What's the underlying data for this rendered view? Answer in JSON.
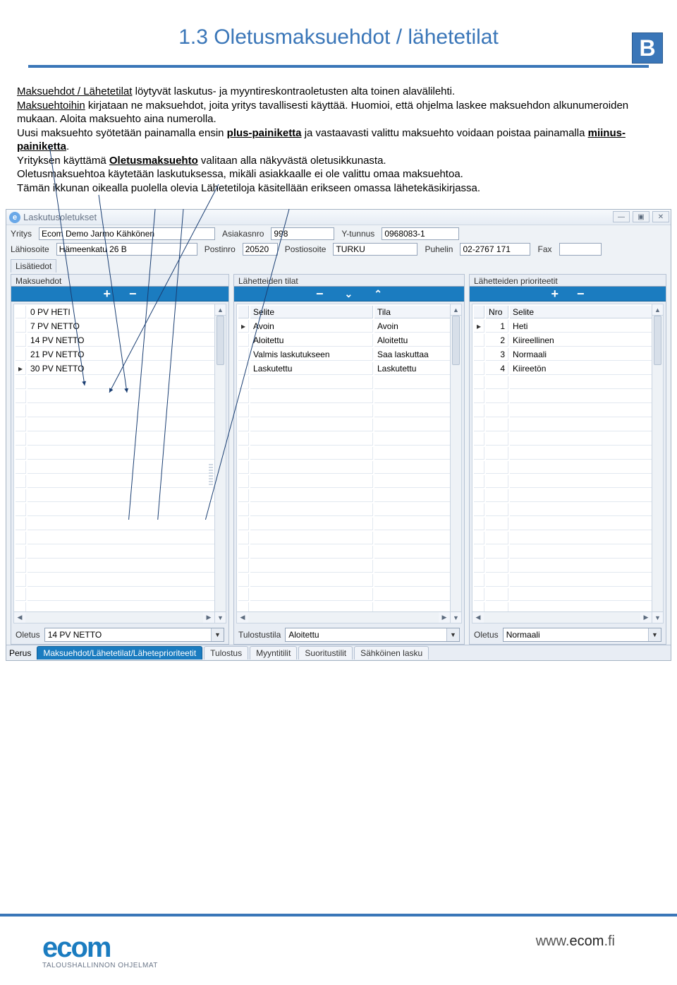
{
  "badge": "B",
  "title": "1.3 Oletusmaksuehdot / lähetetilat",
  "explanation": {
    "l1a": "Maksuehdot / Lähetetilat",
    "l1b": " löytyvät laskutus- ja myyntireskontraoletusten alta toinen alavälilehti.",
    "l2a": "Maksuehtoihin",
    "l2b": " kirjataan ne maksuehdot, joita yritys tavallisesti käyttää. Huomioi, että ohjelma laskee maksuehdon alkunumeroiden mukaan. Aloita maksuehto aina numerolla.",
    "l3a": "Uusi maksuehto syötetään painamalla ensin ",
    "l3b": "plus-painiketta",
    "l3c": " ja vastaavasti valittu maksuehto voidaan poistaa painamalla ",
    "l3d": "miinus-painiketta",
    "l3e": ".",
    "l4a": "Yrityksen käyttämä ",
    "l4b": "Oletusmaksuehto",
    "l4c": " valitaan alla näkyvästä oletusikkunasta.",
    "l5": "Oletusmaksuehtoa käytetään laskutuksessa, mikäli asiakkaalle ei ole valittu omaa maksuehtoa.",
    "l6": "Tämän ikkunan oikealla puolella olevia Lähetetiloja käsitellään erikseen omassa lähetekäsikirjassa."
  },
  "window": {
    "icon": "e",
    "title": "Laskutusoletukset"
  },
  "header": {
    "yritys_lbl": "Yritys",
    "yritys": "Ecom Demo Jarmo Kähkönen",
    "asiakasnro_lbl": "Asiakasnro",
    "asiakasnro": "998",
    "ytunnus_lbl": "Y-tunnus",
    "ytunnus": "0968083-1",
    "lahiosoite_lbl": "Lähiosoite",
    "lahiosoite": "Hämeenkatu 26 B",
    "postinro_lbl": "Postinro",
    "postinro": "20520",
    "postiosoite_lbl": "Postiosoite",
    "postiosoite": "TURKU",
    "puhelin_lbl": "Puhelin",
    "puhelin": "02-2767 171",
    "fax_lbl": "Fax",
    "fax": ""
  },
  "top_tab": "Lisätiedot",
  "panel1": {
    "title": "Maksuehdot",
    "rows": [
      "0 PV HETI",
      "7 PV NETTO",
      "14 PV NETTO",
      "21 PV NETTO",
      "30 PV NETTO"
    ],
    "selected_index": 4,
    "footer_lbl": "Oletus",
    "footer_value": "14 PV NETTO"
  },
  "panel2": {
    "title": "Lähetteiden tilat",
    "col1": "Selite",
    "col2": "Tila",
    "rows": [
      {
        "selite": "Avoin",
        "tila": "Avoin"
      },
      {
        "selite": "Aloitettu",
        "tila": "Aloitettu"
      },
      {
        "selite": "Valmis laskutukseen",
        "tila": "Saa laskuttaa"
      },
      {
        "selite": "Laskutettu",
        "tila": "Laskutettu"
      }
    ],
    "selected_index": 0,
    "footer_lbl": "Tulostustila",
    "footer_value": "Aloitettu"
  },
  "panel3": {
    "title": "Lähetteiden prioriteetit",
    "col1": "Nro",
    "col2": "Selite",
    "rows": [
      {
        "nro": "1",
        "selite": "Heti"
      },
      {
        "nro": "2",
        "selite": "Kiireellinen"
      },
      {
        "nro": "3",
        "selite": "Normaali"
      },
      {
        "nro": "4",
        "selite": "Kiireetön"
      }
    ],
    "selected_index": 0,
    "footer_lbl": "Oletus",
    "footer_value": "Normaali"
  },
  "bottom_tabs": {
    "lbl": "Perus",
    "items": [
      "Maksuehdot/Lähetetilat/Läheteprioriteetit",
      "Tulostus",
      "Myyntitilit",
      "Suoritustilit",
      "Sähköinen lasku"
    ],
    "active_index": 0
  },
  "footer": {
    "logo": "ecom",
    "sub": "TALOUSHALLINNON OHJELMAT",
    "url_pre": "www.",
    "url_main": "ecom",
    "url_post": ".fi"
  }
}
